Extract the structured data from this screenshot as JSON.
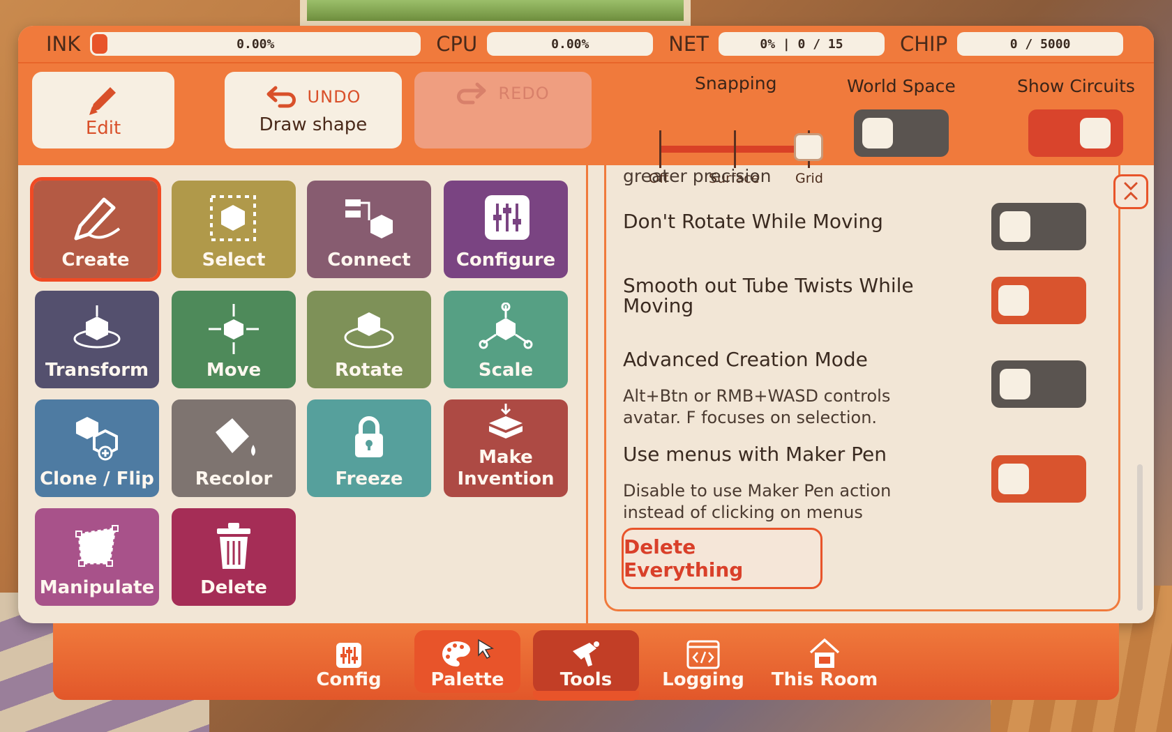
{
  "stats": {
    "ink_label": "INK",
    "ink_value": "0.00%",
    "ink_fraction": 0.0,
    "cpu_label": "CPU",
    "cpu_value": "0.00%",
    "net_label": "NET",
    "net_value": "0% | 0 / 15",
    "chip_label": "CHIP",
    "chip_value": "0 / 5000"
  },
  "toolbar": {
    "edit_label": "Edit",
    "undo_label": "UNDO",
    "undo_action": "Draw shape",
    "redo_label": "REDO",
    "snapping_title": "Snapping",
    "snapping_options": [
      "Off",
      "Surface",
      "Grid"
    ],
    "snapping_selected": "Grid",
    "world_space_label": "World Space",
    "world_space_on": false,
    "show_circuits_label": "Show Circuits",
    "show_circuits_on": true
  },
  "tools": [
    {
      "label": "Create",
      "color": "#b45a44",
      "selected": true
    },
    {
      "label": "Select",
      "color": "#b0994a"
    },
    {
      "label": "Connect",
      "color": "#875c70"
    },
    {
      "label": "Configure",
      "color": "#7a4482"
    },
    {
      "label": "Transform",
      "color": "#54506e"
    },
    {
      "label": "Move",
      "color": "#4e8a5a"
    },
    {
      "label": "Rotate",
      "color": "#7e9158"
    },
    {
      "label": "Scale",
      "color": "#56a084"
    },
    {
      "label": "Clone / Flip",
      "color": "#4e7ba2"
    },
    {
      "label": "Recolor",
      "color": "#7e7470"
    },
    {
      "label": "Freeze",
      "color": "#56a09c"
    },
    {
      "label": "Make Invention",
      "color": "#ad4a44"
    },
    {
      "label": "Manipulate",
      "color": "#a8528a"
    },
    {
      "label": "Delete",
      "color": "#a52d56"
    }
  ],
  "settings": {
    "partial_text": "greater precision",
    "dont_rotate": {
      "title": "Don't Rotate While Moving",
      "on": false
    },
    "smooth_tubes": {
      "title": "Smooth out Tube Twists While Moving",
      "on": true
    },
    "advanced_mode": {
      "title": "Advanced Creation Mode",
      "desc": "Alt+Btn or RMB+WASD controls avatar. F focuses on selection.",
      "on": false
    },
    "maker_pen_menus": {
      "title": "Use menus with Maker Pen",
      "desc": "Disable to use Maker Pen action instead of clicking on menus",
      "on": true
    },
    "delete_everything": "Delete Everything"
  },
  "nav": [
    {
      "label": "Config",
      "icon": "sliders-icon"
    },
    {
      "label": "Palette",
      "icon": "palette-icon"
    },
    {
      "label": "Tools",
      "icon": "maker-pen-icon",
      "active": true
    },
    {
      "label": "Logging",
      "icon": "code-window-icon"
    },
    {
      "label": "This Room",
      "icon": "room-house-icon"
    }
  ]
}
